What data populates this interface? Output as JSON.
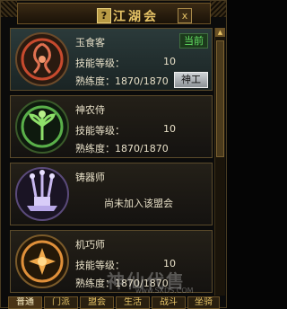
{
  "window": {
    "title": "江湖会",
    "help_label": "?",
    "close_label": "x"
  },
  "labels": {
    "skill_level": "技能等级：",
    "proficiency": "熟练度：1870/1870"
  },
  "professions": [
    {
      "name": "玉食客",
      "level": "10",
      "proficiency_value": "熟练度：1870/1870",
      "badge": "当前",
      "rank_button": "神工",
      "emblem": "dragon-emblem-icon"
    },
    {
      "name": "神农侍",
      "level": "10",
      "proficiency_value": "熟练度：1870/1870",
      "emblem": "herb-emblem-icon"
    },
    {
      "name": "铸器师",
      "status": "尚未加入该盟会",
      "emblem": "forge-emblem-icon"
    },
    {
      "name": "机巧师",
      "level": "10",
      "proficiency_value": "熟练度：1870/1870",
      "emblem": "gear-emblem-icon"
    }
  ],
  "tabs": [
    "普通",
    "门派",
    "盟会",
    "生活",
    "战斗",
    "坐骑"
  ],
  "watermark": {
    "text": "神仙代售",
    "url": "www.SXDS.COM"
  },
  "colors": {
    "accent": "#e6c366",
    "current": "#63e063"
  }
}
